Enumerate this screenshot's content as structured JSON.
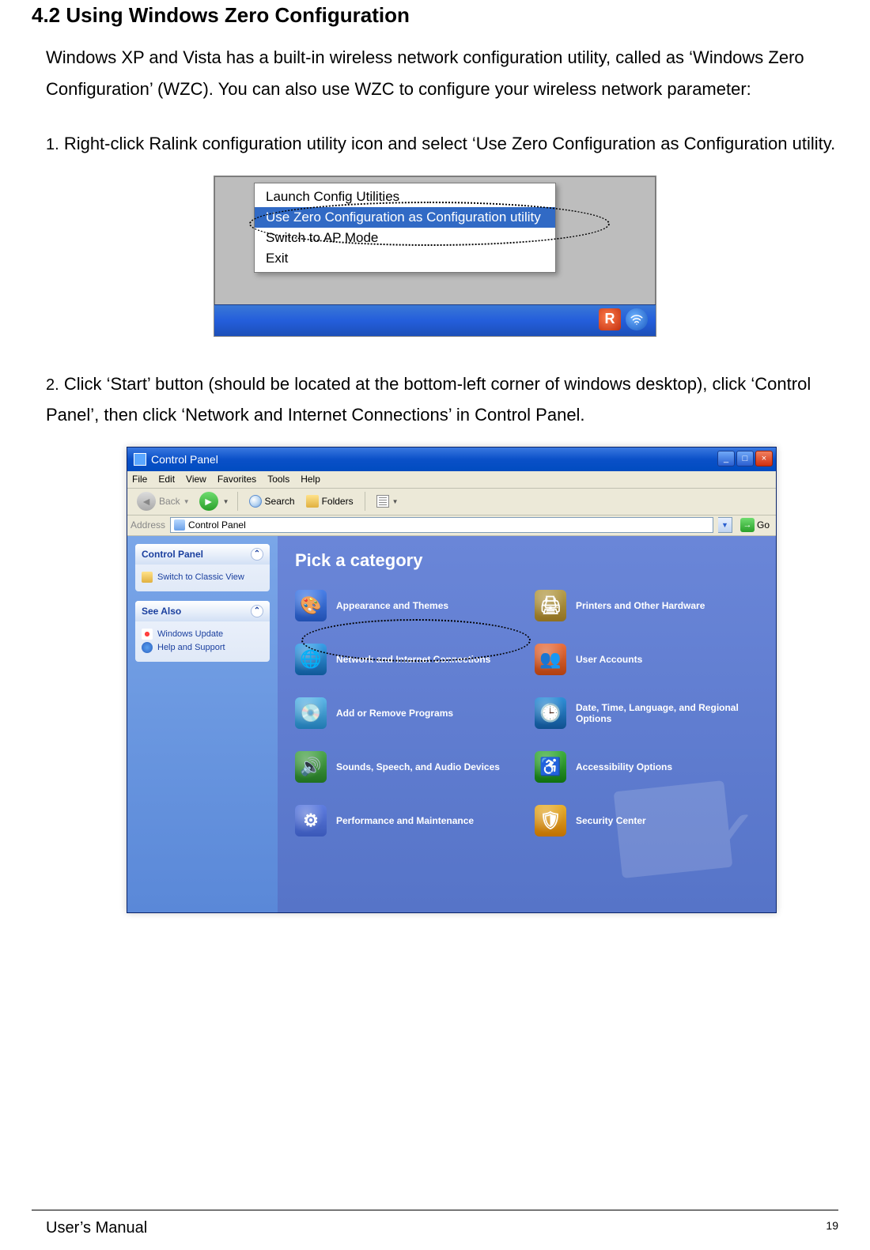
{
  "section_title": "4.2 Using Windows Zero Configuration",
  "intro": "Windows XP and Vista has a built-in wireless network configuration utility, called as ‘Windows Zero Configuration’ (WZC). You can also use WZC to configure your wireless network parameter:",
  "step1_num": "1.",
  "step1": "Right-click Ralink configuration utility icon and select ‘Use Zero Configuration as Configuration utility.",
  "ctx_menu": {
    "items": [
      "Launch Config Utilities",
      "Use Zero Configuration as Configuration utility",
      "Switch to AP Mode",
      "Exit"
    ],
    "selected_index": 1
  },
  "step2_num": "2.",
  "step2": "Click ‘Start’ button (should be located at the bottom-left corner of windows desktop), click ‘Control Panel’, then click ‘Network and Internet Connections’ in Control Panel.",
  "control_panel": {
    "title": "Control Panel",
    "menu": {
      "file": "File",
      "edit": "Edit",
      "view": "View",
      "favorites": "Favorites",
      "tools": "Tools",
      "help": "Help"
    },
    "toolbar": {
      "back": "Back",
      "search": "Search",
      "folders": "Folders"
    },
    "address_label": "Address",
    "address_value": "Control Panel",
    "go": "Go",
    "side": {
      "panel1_title": "Control Panel",
      "panel1_item": "Switch to Classic View",
      "panel2_title": "See Also",
      "panel2_item1": "Windows Update",
      "panel2_item2": "Help and Support"
    },
    "pick": "Pick a category",
    "categories": {
      "appearance": "Appearance and Themes",
      "printers": "Printers and Other Hardware",
      "network": "Network and Internet Connections",
      "users": "User Accounts",
      "addremove": "Add or Remove Programs",
      "datetime": "Date, Time, Language, and Regional Options",
      "sounds": "Sounds, Speech, and Audio Devices",
      "access": "Accessibility Options",
      "perf": "Performance and Maintenance",
      "security": "Security Center"
    }
  },
  "footer_left": "User’s Manual",
  "footer_right": "19"
}
